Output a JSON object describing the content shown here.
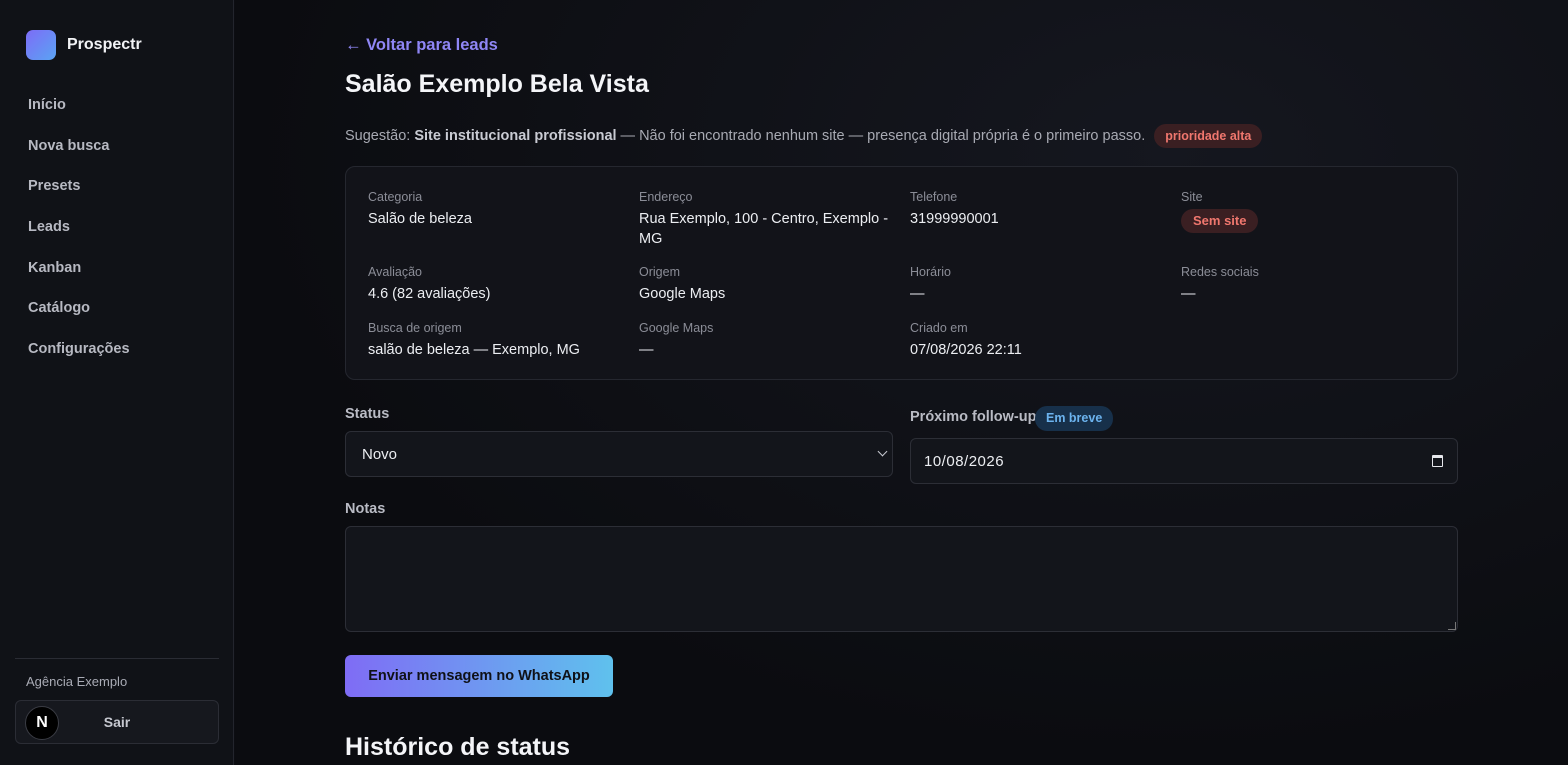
{
  "app": {
    "name": "Prospectr"
  },
  "sidebar": {
    "items": [
      {
        "label": "Início"
      },
      {
        "label": "Nova busca"
      },
      {
        "label": "Presets"
      },
      {
        "label": "Leads"
      },
      {
        "label": "Kanban"
      },
      {
        "label": "Catálogo"
      },
      {
        "label": "Configurações"
      }
    ],
    "agency": "Agência Exemplo",
    "logout_label": "Sair",
    "avatar_letter": "N"
  },
  "lead": {
    "back_label": "← Voltar para leads",
    "title": "Salão Exemplo Bela Vista",
    "suggestion": {
      "prefix": "Sugestão:",
      "name": "Site institucional profissional",
      "description": "— Não foi encontrado nenhum site — presença digital própria é o primeiro passo.",
      "priority": "prioridade alta"
    },
    "fields": {
      "categoria": {
        "label": "Categoria",
        "value": "Salão de beleza"
      },
      "endereco": {
        "label": "Endereço",
        "value": "Rua Exemplo, 100 - Centro, Exemplo - MG"
      },
      "telefone": {
        "label": "Telefone",
        "value": "31999990001"
      },
      "site": {
        "label": "Site",
        "value": "Sem site"
      },
      "avaliacao": {
        "label": "Avaliação",
        "value": "4.6 (82 avaliações)"
      },
      "origem": {
        "label": "Origem",
        "value": "Google Maps"
      },
      "horario": {
        "label": "Horário",
        "value": "—"
      },
      "redes": {
        "label": "Redes sociais",
        "value": "—"
      },
      "busca": {
        "label": "Busca de origem",
        "value": "salão de beleza — Exemplo, MG"
      },
      "gmaps": {
        "label": "Google Maps",
        "value": "—"
      },
      "criado": {
        "label": "Criado em",
        "value": "07/08/2026 22:11"
      }
    }
  },
  "form": {
    "status_label": "Status",
    "status_value": "Novo",
    "followup_label": "Próximo follow-up",
    "followup_badge": "Em breve",
    "followup_value": "10/08/2026",
    "notes_label": "Notas",
    "notes_value": ""
  },
  "actions": {
    "whatsapp_label": "Enviar mensagem no WhatsApp"
  },
  "history": {
    "title": "Histórico de status"
  },
  "colors": {
    "accent": "#8f86f5",
    "danger_badge_text": "#f0776e",
    "info_badge_text": "#6cb3ee"
  }
}
